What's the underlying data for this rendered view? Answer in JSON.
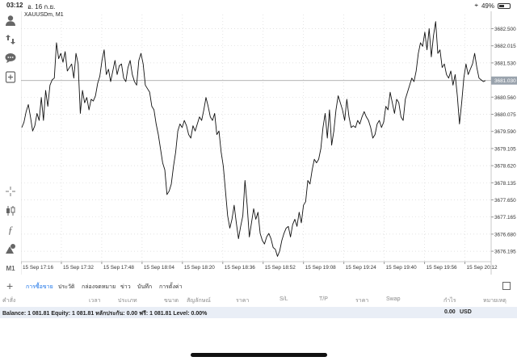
{
  "status_bar": {
    "time": "03:12",
    "date": "อ. 16 ก.ย.",
    "battery": "49%",
    "battery_level": 0.49
  },
  "sidebar": {
    "icons": [
      "person-icon",
      "trade-icon",
      "chat-icon",
      "add-chart-icon",
      "crosshair-icon",
      "candles-icon",
      "function-icon",
      "shapes-icon"
    ],
    "timeframe": "M1"
  },
  "chart": {
    "symbol": "XAUUSDm, M1",
    "current_price": "3681.030",
    "price_labels": [
      "3682.500",
      "3682.015",
      "3681.530",
      "3681.030",
      "3680.560",
      "3680.075",
      "3679.590",
      "3679.105",
      "3678.620",
      "3678.135",
      "3677.650",
      "3677.165",
      "3676.680",
      "3676.195"
    ],
    "time_labels": [
      "15 Sep 17:16",
      "15 Sep 17:32",
      "15 Sep 17:48",
      "15 Sep 18:04",
      "15 Sep 18:20",
      "15 Sep 18:36",
      "15 Sep 18:52",
      "15 Sep 19:08",
      "15 Sep 19:24",
      "15 Sep 19:40",
      "15 Sep 19:56",
      "15 Sep 20:12"
    ]
  },
  "chart_data": {
    "type": "line",
    "title": "XAUUSDm, M1",
    "x_ticks": [
      "15 Sep 17:16",
      "15 Sep 17:32",
      "15 Sep 17:48",
      "15 Sep 18:04",
      "15 Sep 18:20",
      "15 Sep 18:36",
      "15 Sep 18:52",
      "15 Sep 19:08",
      "15 Sep 19:24",
      "15 Sep 19:40",
      "15 Sep 19:56",
      "15 Sep 20:12"
    ],
    "ylim": [
      3675.9,
      3682.9
    ],
    "grid": true,
    "series": [
      {
        "values": [
          3679.7,
          3679.85,
          3680.15,
          3680.35,
          3680.0,
          3679.6,
          3679.75,
          3680.1,
          3679.9,
          3680.55,
          3679.9,
          3680.75,
          3680.3,
          3680.9,
          3681.05,
          3681.1,
          3682.1,
          3681.65,
          3681.8,
          3681.55,
          3681.85,
          3681.3,
          3681.4,
          3681.5,
          3681.1,
          3681.8,
          3681.5,
          3680.1,
          3680.75,
          3680.4,
          3680.55,
          3680.2,
          3680.5,
          3680.45,
          3680.6,
          3680.95,
          3681.15,
          3681.6,
          3681.9,
          3681.2,
          3681.35,
          3681.0,
          3681.3,
          3681.6,
          3681.2,
          3681.45,
          3681.5,
          3681.1,
          3681.0,
          3681.4,
          3681.6,
          3681.2,
          3681.0,
          3680.9,
          3681.6,
          3681.8,
          3681.5,
          3680.9,
          3680.8,
          3680.7,
          3680.3,
          3680.2,
          3679.8,
          3679.5,
          3679.1,
          3678.7,
          3678.5,
          3677.8,
          3677.9,
          3678.1,
          3678.6,
          3679.0,
          3679.6,
          3679.8,
          3679.7,
          3679.9,
          3679.75,
          3679.5,
          3679.4,
          3679.75,
          3679.6,
          3679.8,
          3680.0,
          3679.9,
          3680.2,
          3680.55,
          3680.3,
          3680.0,
          3679.9,
          3680.1,
          3679.5,
          3679.6,
          3679.0,
          3678.6,
          3677.9,
          3677.2,
          3676.85,
          3677.1,
          3677.5,
          3677.0,
          3676.55,
          3676.9,
          3677.2,
          3678.2,
          3677.5,
          3676.6,
          3677.0,
          3677.4,
          3677.1,
          3677.3,
          3676.7,
          3676.5,
          3676.4,
          3676.6,
          3676.7,
          3676.55,
          3676.3,
          3676.25,
          3676.05,
          3676.2,
          3676.5,
          3676.7,
          3676.85,
          3676.9,
          3676.6,
          3676.95,
          3677.1,
          3676.9,
          3677.3,
          3677.0,
          3677.5,
          3677.6,
          3678.2,
          3678.1,
          3678.5,
          3678.8,
          3678.7,
          3678.8,
          3679.1,
          3679.7,
          3680.1,
          3679.4,
          3680.2,
          3679.2,
          3679.6,
          3680.2,
          3680.6,
          3680.4,
          3680.2,
          3679.9,
          3680.5,
          3680.0,
          3679.7,
          3679.75,
          3679.7,
          3679.9,
          3679.8,
          3680.0,
          3680.15,
          3680.0,
          3679.9,
          3679.7,
          3679.4,
          3679.5,
          3679.8,
          3679.9,
          3679.7,
          3679.85,
          3680.3,
          3680.2,
          3680.7,
          3680.4,
          3680.1,
          3680.5,
          3680.4,
          3680.0,
          3679.9,
          3680.5,
          3680.7,
          3680.9,
          3681.1,
          3681.0,
          3681.3,
          3681.8,
          3682.1,
          3682.0,
          3682.4,
          3681.9,
          3682.5,
          3681.7,
          3682.3,
          3682.7,
          3681.8,
          3681.9,
          3681.4,
          3681.5,
          3681.2,
          3681.1,
          3681.3,
          3680.9,
          3681.2,
          3680.6,
          3679.8,
          3680.4,
          3681.1,
          3681.5,
          3681.2,
          3681.35,
          3681.5,
          3681.8,
          3681.4,
          3681.1,
          3681.05,
          3681.0,
          3681.03
        ]
      }
    ]
  },
  "toolbox": {
    "plus": "+",
    "tabs": [
      "การซื้อขาย",
      "ประวัติ",
      "กล่องจดหมาย",
      "ข่าว",
      "บันทึก",
      "การตั้งค่า"
    ],
    "columns": [
      "คำสั่ง",
      "เวลา",
      "ประเภท",
      "ขนาด",
      "สัญลักษณ์",
      "ราคา",
      "S/L",
      "T/P",
      "ราคา",
      "Swap",
      "กำไร",
      "หมายเหตุ"
    ],
    "balance_text": "Balance: 1 081.81 Equity: 1 081.81 หลักประกัน: 0.00 ฟรี: 1 081.81 Level: 0.00%",
    "profit": "0.00",
    "currency": "USD"
  }
}
